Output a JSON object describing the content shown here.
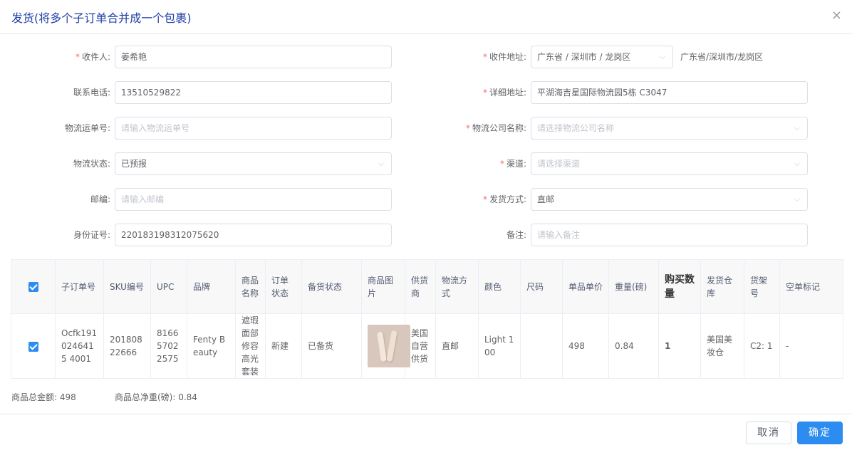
{
  "dialog": {
    "title": "发货(将多个子订单合并成一个包裹)",
    "close_glyph": "×"
  },
  "form": {
    "recipient": {
      "label": "收件人:",
      "value": "姜希艳",
      "required": true
    },
    "address": {
      "label": "收件地址:",
      "value": "广东省 / 深圳市 / 龙岗区",
      "text": "广东省/深圳市/龙岗区",
      "required": true
    },
    "phone": {
      "label": "联系电话:",
      "value": "13510529822"
    },
    "detail_address": {
      "label": "详细地址:",
      "value": "平湖海吉星国际物流园5栋 C3047",
      "required": true
    },
    "tracking_no": {
      "label": "物流运单号:",
      "placeholder": "请输入物流运单号"
    },
    "logistics_company": {
      "label": "物流公司名称:",
      "placeholder": "请选择物流公司名称",
      "required": true
    },
    "logistics_status": {
      "label": "物流状态:",
      "value": "已预报"
    },
    "channel": {
      "label": "渠道:",
      "placeholder": "请选择渠道",
      "required": true
    },
    "postcode": {
      "label": "邮编:",
      "placeholder": "请输入邮编"
    },
    "ship_method": {
      "label": "发货方式:",
      "value": "直邮",
      "required": true
    },
    "id_card": {
      "label": "身份证号:",
      "value": "220183198312075620"
    },
    "remark": {
      "label": "备注:",
      "placeholder": "请输入备注"
    },
    "required_mark": "*",
    "chevron": "⌵"
  },
  "table": {
    "headers": [
      "子订单号",
      "SKU编号",
      "UPC",
      "品牌",
      "商品名称",
      "订单状态",
      "备货状态",
      "商品图片",
      "供货商",
      "物流方式",
      "颜色",
      "尺码",
      "单品单价",
      "重量(磅)",
      "购买数量",
      "发货仓库",
      "货架号",
      "空单标记"
    ],
    "rows": [
      {
        "order_no": "Ocfk1910246415 4001",
        "sku": "20180822666",
        "upc": "816657022575",
        "brand": "Fenty Beauty",
        "name": "遮瑕面部修容高光套装",
        "order_status": "新建",
        "stock_status": "已备货",
        "supplier": "美国自营供货",
        "logistics": "直邮",
        "color": "Light 100",
        "size": "",
        "price": "498",
        "weight": "0.84",
        "qty": "1",
        "warehouse": "美国美妆仓",
        "shelf": "C2: 1",
        "empty_flag": "-",
        "checked": true
      }
    ]
  },
  "summary": {
    "total_amount": "商品总金额: 498",
    "total_weight": "商品总净重(磅): 0.84"
  },
  "buttons": {
    "cancel": "取消",
    "ok": "确定"
  },
  "colors": {
    "primary": "#2d8cf0",
    "title": "#1f3fa8",
    "required": "#f56c6c"
  }
}
